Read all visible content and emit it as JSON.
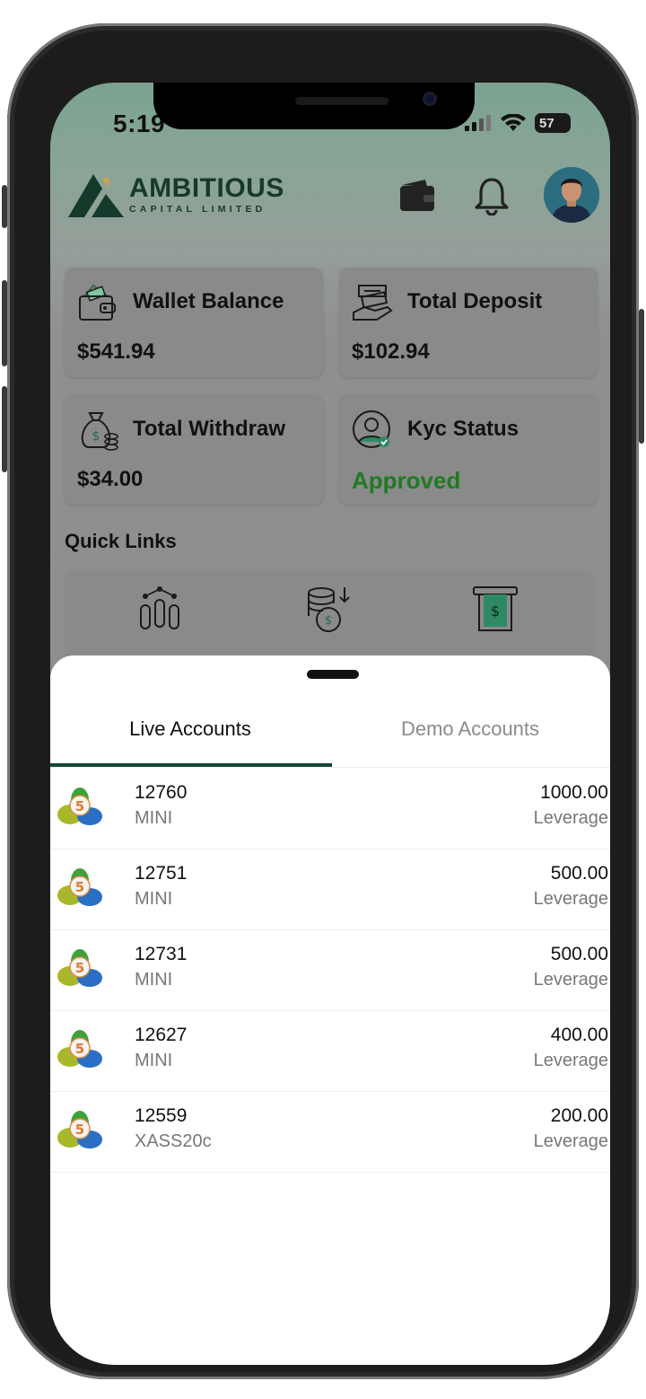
{
  "status_bar": {
    "time": "5:19",
    "battery": "57"
  },
  "header": {
    "brand_name": "AMBITIOUS",
    "brand_sub": "CAPITAL LIMITED",
    "icons": [
      "wallet-icon",
      "bell-icon",
      "avatar"
    ]
  },
  "cards": [
    {
      "label": "Wallet Balance",
      "value": "$541.94",
      "icon": "wallet-money-icon"
    },
    {
      "label": "Total Deposit",
      "value": "$102.94",
      "icon": "deposit-hand-icon"
    },
    {
      "label": "Total Withdraw",
      "value": "$34.00",
      "icon": "money-bag-icon"
    },
    {
      "label": "Kyc Status",
      "value": "Approved",
      "icon": "user-verified-icon"
    }
  ],
  "quick_links": {
    "title": "Quick Links",
    "items": [
      "candlestick-icon",
      "coin-stack-icon",
      "atm-cash-icon"
    ]
  },
  "sheet": {
    "tabs": [
      "Live Accounts",
      "Demo Accounts"
    ],
    "active_tab": 0,
    "accounts": [
      {
        "number": "12760",
        "type": "MINI",
        "amount": "1000.00",
        "amount_label": "Leverage"
      },
      {
        "number": "12751",
        "type": "MINI",
        "amount": "500.00",
        "amount_label": "Leverage"
      },
      {
        "number": "12731",
        "type": "MINI",
        "amount": "500.00",
        "amount_label": "Leverage"
      },
      {
        "number": "12627",
        "type": "MINI",
        "amount": "400.00",
        "amount_label": "Leverage"
      },
      {
        "number": "12559",
        "type": "XASS20c",
        "amount": "200.00",
        "amount_label": "Leverage"
      }
    ]
  },
  "colors": {
    "brand": "#153a2b",
    "approved": "#1f7a22",
    "tab_indicator": "#17453a"
  }
}
